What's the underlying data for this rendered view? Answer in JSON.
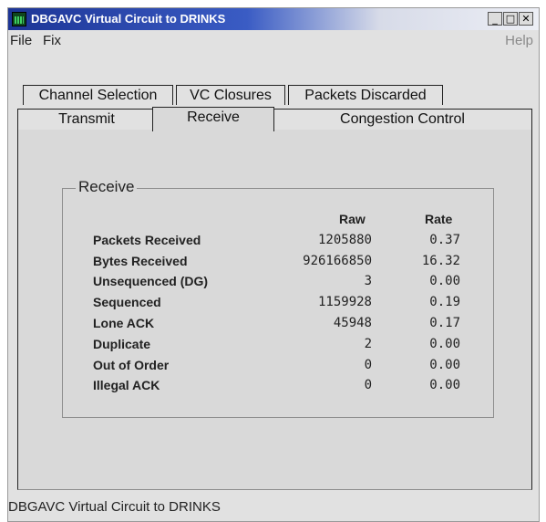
{
  "window": {
    "title": "DBGAVC Virtual Circuit to DRINKS",
    "minimize_glyph": "_",
    "maximize_glyph": "□",
    "close_glyph": "✕"
  },
  "menu": {
    "file": "File",
    "fix": "Fix",
    "help": "Help"
  },
  "tabs": {
    "row1": [
      {
        "label": "Channel Selection"
      },
      {
        "label": "VC Closures"
      },
      {
        "label": "Packets Discarded"
      }
    ],
    "row2": [
      {
        "label": "Transmit"
      },
      {
        "label": "Receive"
      },
      {
        "label": "Congestion Control"
      }
    ],
    "active": "Receive"
  },
  "receive": {
    "group_label": "Receive",
    "columns": {
      "raw": "Raw",
      "rate": "Rate"
    },
    "rows": [
      {
        "label": "Packets Received",
        "raw": "1205880",
        "rate": "0.37"
      },
      {
        "label": "Bytes Received",
        "raw": "926166850",
        "rate": "16.32"
      },
      {
        "label": "Unsequenced (DG)",
        "raw": "3",
        "rate": "0.00"
      },
      {
        "label": "Sequenced",
        "raw": "1159928",
        "rate": "0.19"
      },
      {
        "label": "Lone ACK",
        "raw": "45948",
        "rate": "0.17"
      },
      {
        "label": "Duplicate",
        "raw": "2",
        "rate": "0.00"
      },
      {
        "label": "Out of Order",
        "raw": "0",
        "rate": "0.00"
      },
      {
        "label": "Illegal ACK",
        "raw": "0",
        "rate": "0.00"
      }
    ]
  },
  "status": {
    "text": "DBGAVC Virtual Circuit to DRINKS"
  }
}
